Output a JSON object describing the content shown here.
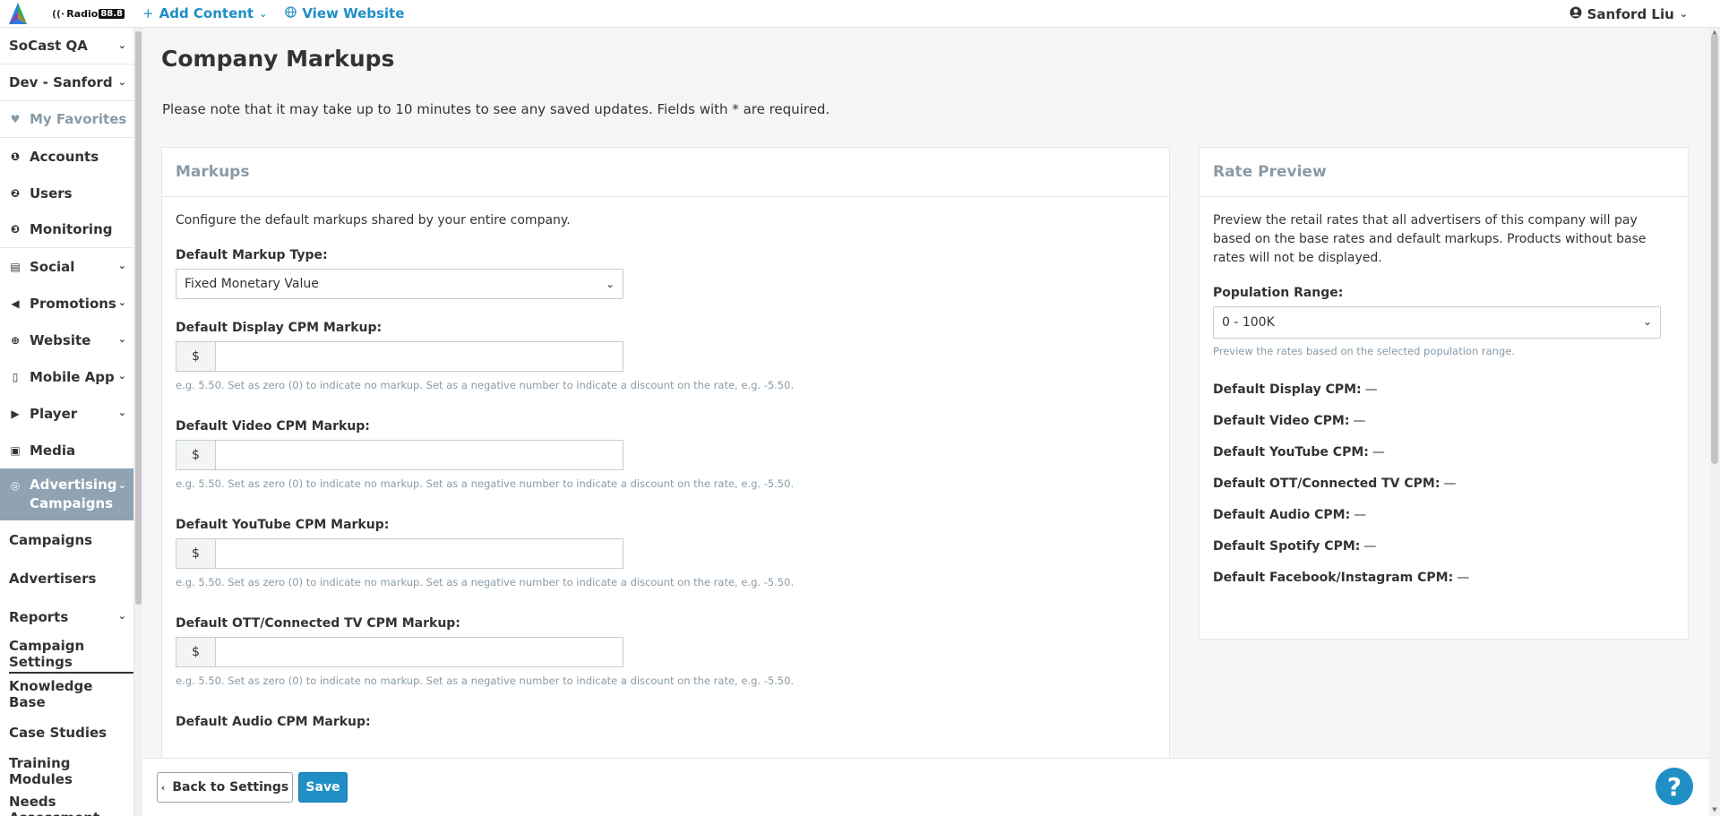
{
  "topbar": {
    "brand_name": "Radio",
    "brand_freq": "88.8",
    "add_content": "Add Content",
    "view_website": "View Website",
    "user_name": "Sanford Liu"
  },
  "sidebar": {
    "org": "SoCast QA",
    "site": "Dev - Sanford",
    "items": [
      {
        "label": "My Favorites",
        "icon": "heart-icon"
      },
      {
        "label": "Accounts",
        "icon": "number-1-icon"
      },
      {
        "label": "Users",
        "icon": "number-2-icon"
      },
      {
        "label": "Monitoring",
        "icon": "number-3-icon"
      },
      {
        "label": "Social",
        "icon": "comment-icon"
      },
      {
        "label": "Promotions",
        "icon": "megaphone-icon"
      },
      {
        "label": "Website",
        "icon": "globe-icon"
      },
      {
        "label": "Mobile App",
        "icon": "mobile-icon"
      },
      {
        "label": "Player",
        "icon": "play-icon"
      },
      {
        "label": "Media",
        "icon": "image-icon"
      }
    ],
    "active_section": {
      "line1": "Advertising",
      "line2": "Campaigns",
      "icon": "target-icon"
    },
    "subitems": [
      {
        "label": "Campaigns"
      },
      {
        "label": "Advertisers"
      },
      {
        "label": "Reports"
      },
      {
        "label": "Campaign Settings"
      },
      {
        "label": "Knowledge Base"
      },
      {
        "label": "Case Studies"
      },
      {
        "label": "Training Modules"
      },
      {
        "label": "Needs Assessment"
      }
    ]
  },
  "page": {
    "title": "Company Markups",
    "note": "Please note that it may take up to 10 minutes to see any saved updates. Fields with * are required."
  },
  "markups": {
    "header": "Markups",
    "description": "Configure the default markups shared by your entire company.",
    "type_label": "Default Markup Type:",
    "type_value": "Fixed Monetary Value",
    "currency": "$",
    "help": "e.g. 5.50. Set as zero (0) to indicate no markup. Set as a negative number to indicate a discount on the rate, e.g. -5.50.",
    "fields": [
      {
        "label": "Default Display CPM Markup:",
        "value": ""
      },
      {
        "label": "Default Video CPM Markup:",
        "value": ""
      },
      {
        "label": "Default YouTube CPM Markup:",
        "value": ""
      },
      {
        "label": "Default OTT/Connected TV CPM Markup:",
        "value": ""
      }
    ],
    "next_label": "Default Audio CPM Markup:"
  },
  "preview": {
    "header": "Rate Preview",
    "description": "Preview the retail rates that all advertisers of this company will pay based on the base rates and default markups. Products without base rates will not be displayed.",
    "range_label": "Population Range:",
    "range_value": "0 - 100K",
    "range_help": "Preview the rates based on the selected population range.",
    "rates": [
      {
        "label": "Default Display CPM:",
        "value": "—"
      },
      {
        "label": "Default Video CPM:",
        "value": "—"
      },
      {
        "label": "Default YouTube CPM:",
        "value": "—"
      },
      {
        "label": "Default OTT/Connected TV CPM:",
        "value": "—"
      },
      {
        "label": "Default Audio CPM:",
        "value": "—"
      },
      {
        "label": "Default Spotify CPM:",
        "value": "—"
      },
      {
        "label": "Default Facebook/Instagram CPM:",
        "value": "—"
      }
    ]
  },
  "actions": {
    "back": "Back to Settings",
    "save": "Save",
    "help": "?"
  },
  "colors": {
    "accent": "#1f8fc6",
    "sidebar_active": "#8fa3b3",
    "muted_text": "#8a9ba8"
  }
}
